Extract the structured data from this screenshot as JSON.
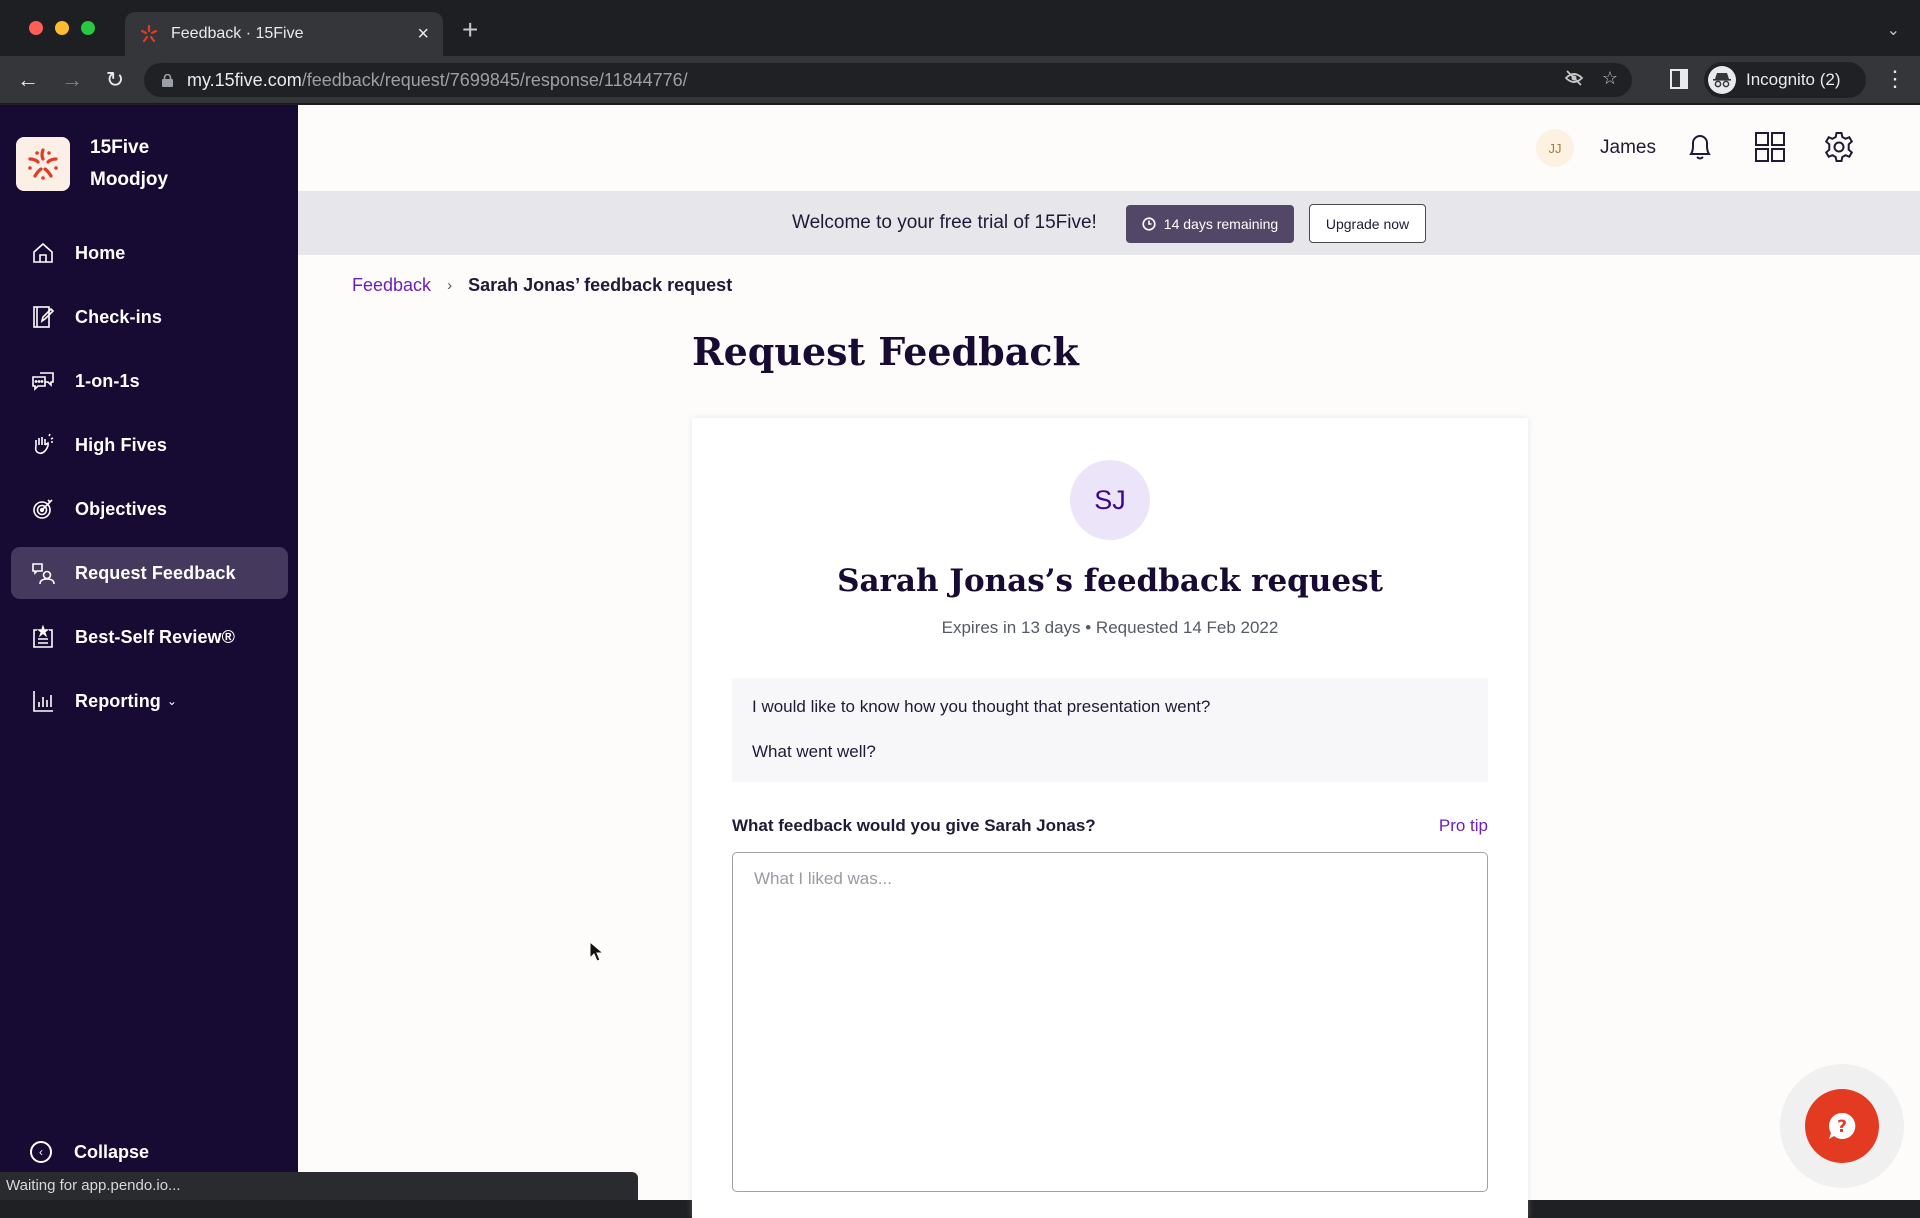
{
  "browser": {
    "tab_title": "Feedback · 15Five",
    "url_host": "my.15five.com",
    "url_path": "/feedback/request/7699845/response/11844776/",
    "profile_label": "Incognito (2)",
    "icons": [
      "back-icon",
      "forward-icon",
      "reload-icon",
      "lock-icon",
      "eye-off-icon",
      "star-icon",
      "side-panel-icon",
      "incognito-icon",
      "kebab-menu-icon",
      "tab-list-chevron-icon"
    ]
  },
  "sidebar": {
    "org_name_line1": "15Five",
    "org_name_line2": "Moodjoy",
    "items": [
      {
        "label": "Home",
        "icon": "home-icon",
        "active": false
      },
      {
        "label": "Check-ins",
        "icon": "check-ins-icon",
        "active": false
      },
      {
        "label": "1-on-1s",
        "icon": "chat-bubbles-icon",
        "active": false
      },
      {
        "label": "High Fives",
        "icon": "high-five-hand-icon",
        "active": false
      },
      {
        "label": "Objectives",
        "icon": "target-icon",
        "active": false
      },
      {
        "label": "Request Feedback",
        "icon": "request-feedback-icon",
        "active": true
      },
      {
        "label": "Best-Self Review®",
        "icon": "review-clipboard-icon",
        "active": false
      },
      {
        "label": "Reporting",
        "icon": "bar-chart-icon",
        "active": false,
        "has_dropdown": true
      }
    ],
    "collapse_label": "Collapse"
  },
  "topbar": {
    "user_initials": "JJ",
    "user_name": "James"
  },
  "trial_banner": {
    "message": "Welcome to your free trial of 15Five!",
    "days_remaining": "14 days remaining",
    "upgrade_label": "Upgrade now"
  },
  "breadcrumb": {
    "parent": "Feedback",
    "separator": "›",
    "current": "Sarah Jonas’ feedback request"
  },
  "page": {
    "title": "Request Feedback"
  },
  "request_card": {
    "requester_initials": "SJ",
    "title": "Sarah Jonas’s feedback request",
    "meta": "Expires in 13 days • Requested 14 Feb 2022",
    "prompt_lines": [
      "I would like to know how you thought that presentation went?",
      "What went well?"
    ],
    "question_label": "What feedback would you give Sarah Jonas?",
    "pro_tip_label": "Pro tip",
    "answer_value": "",
    "answer_placeholder": "What I liked was..."
  },
  "status_bar": {
    "text": "Waiting for app.pendo.io..."
  },
  "colors": {
    "sidebar_bg": "#170a33",
    "sidebar_active": "#453a5e",
    "accent_link": "#6b1fbf",
    "brand_red": "#e33b22",
    "trial_badge": "#534767"
  }
}
